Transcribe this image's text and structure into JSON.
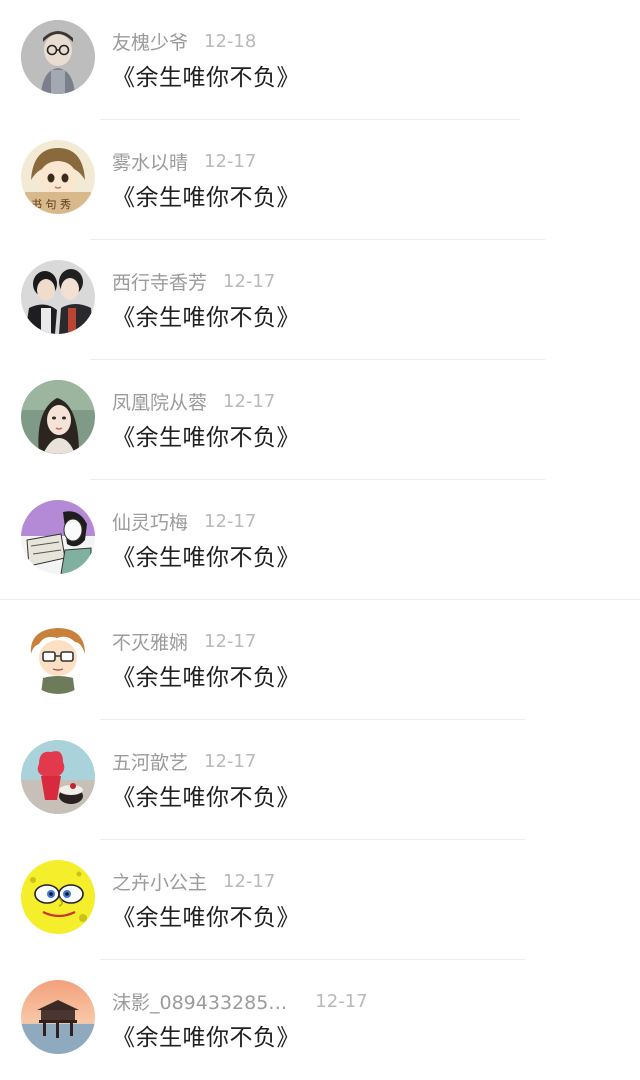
{
  "comments": [
    {
      "name": "友槐少爷",
      "time": "12-18",
      "text": "《余生唯你不负》",
      "avatar_icon": "child-with-glasses-avatar-icon"
    },
    {
      "name": "雾水以晴",
      "time": "12-17",
      "text": "《余生唯你不负》",
      "avatar_icon": "cartoon-girl-avatar-icon"
    },
    {
      "name": "西行寺香芳",
      "time": "12-17",
      "text": "《余生唯你不负》",
      "avatar_icon": "two-boys-avatar-icon"
    },
    {
      "name": "凤凰院从蓉",
      "time": "12-17",
      "text": "《余生唯你不负》",
      "avatar_icon": "girl-portrait-avatar-icon"
    },
    {
      "name": "仙灵巧梅",
      "time": "12-17",
      "text": "《余生唯你不负》",
      "avatar_icon": "comic-sketch-avatar-icon"
    },
    {
      "name": "不灭雅娴",
      "time": "12-17",
      "text": "《余生唯你不负》",
      "avatar_icon": "cartoon-boy-glasses-avatar-icon"
    },
    {
      "name": "五河歆艺",
      "time": "12-17",
      "text": "《余生唯你不负》",
      "avatar_icon": "dessert-avatar-icon"
    },
    {
      "name": "之卉小公主",
      "time": "12-17",
      "text": "《余生唯你不负》",
      "avatar_icon": "sponge-cartoon-avatar-icon"
    },
    {
      "name": "沫影_089433285…",
      "time": "12-17",
      "text": "《余生唯你不负》",
      "avatar_icon": "sunset-pier-avatar-icon"
    }
  ],
  "colors": {
    "name": "#9b9b9b",
    "time": "#b9b9b9",
    "text": "#1f1f1f",
    "divider": "#ededed"
  }
}
